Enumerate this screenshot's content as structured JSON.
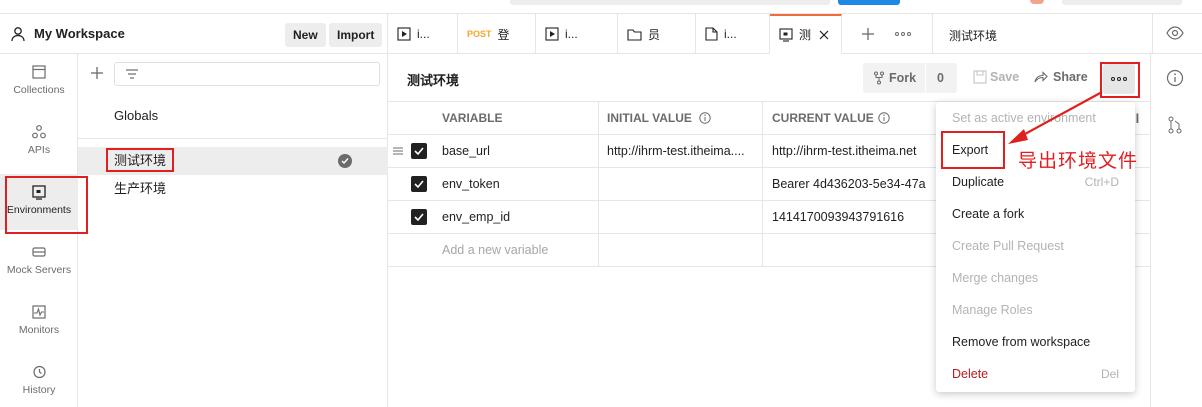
{
  "workspace": {
    "name": "My Workspace",
    "new_label": "New",
    "import_label": "Import"
  },
  "rail": [
    {
      "label": "Collections",
      "icon": "collections-icon"
    },
    {
      "label": "APIs",
      "icon": "apis-icon"
    },
    {
      "label": "Environments",
      "icon": "environments-icon",
      "active": true
    },
    {
      "label": "Mock Servers",
      "icon": "mock-servers-icon"
    },
    {
      "label": "Monitors",
      "icon": "monitors-icon"
    },
    {
      "label": "History",
      "icon": "history-icon"
    }
  ],
  "envlist": {
    "globals": "Globals",
    "items": [
      {
        "name": "测试环境",
        "active": true
      },
      {
        "name": "生产环境"
      }
    ]
  },
  "tabs": [
    {
      "label": "i...",
      "icon": "play-icon"
    },
    {
      "method": "POST",
      "label": "登"
    },
    {
      "label": "i...",
      "icon": "play-icon"
    },
    {
      "label": "员",
      "icon": "folder-icon"
    },
    {
      "label": "i...",
      "icon": "document-icon"
    },
    {
      "label": "测",
      "icon": "environment-tab-icon",
      "active": true
    }
  ],
  "env_selector": "测试环境",
  "main": {
    "title": "测试环境",
    "fork_label": "Fork",
    "fork_count": "0",
    "save_label": "Save",
    "share_label": "Share"
  },
  "table": {
    "headers": {
      "variable": "VARIABLE",
      "initial": "INITIAL VALUE",
      "current": "CURRENT VALUE"
    },
    "rows": [
      {
        "variable": "base_url",
        "initial": "http://ihrm-test.itheima....",
        "current": "http://ihrm-test.itheima.net"
      },
      {
        "variable": "env_token",
        "initial": "",
        "current": "Bearer 4d436203-5e34-47a"
      },
      {
        "variable": "env_emp_id",
        "initial": "",
        "current": "1414170093943791616"
      }
    ],
    "add_placeholder": "Add a new variable"
  },
  "menu": {
    "items": [
      {
        "label": "Set as active environment",
        "disabled": true
      },
      {
        "label": "Export"
      },
      {
        "label": "Duplicate",
        "shortcut": "Ctrl+D"
      },
      {
        "label": "Create a fork"
      },
      {
        "label": "Create Pull Request",
        "disabled": true
      },
      {
        "label": "Merge changes",
        "disabled": true
      },
      {
        "label": "Manage Roles",
        "disabled": true
      },
      {
        "label": "Remove from workspace"
      },
      {
        "label": "Delete",
        "shortcut": "Del",
        "danger": true
      }
    ]
  },
  "annotation": "导出环境文件",
  "colors": {
    "accent": "#f26b3a",
    "annotation": "#e02020",
    "danger": "#b71c1c"
  }
}
